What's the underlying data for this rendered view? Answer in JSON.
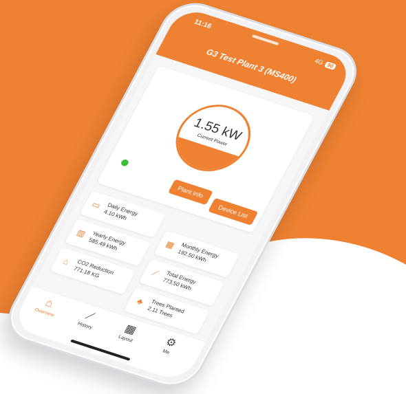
{
  "colors": {
    "accent": "#ef8232",
    "status_online": "#3bbf3b"
  },
  "status_bar": {
    "time": "11:16",
    "network": "4G",
    "battery": "90"
  },
  "header": {
    "title": "G3 Test Plant 3 (MS400)"
  },
  "power": {
    "value": "1.55 kW",
    "label": "Current Power",
    "fill_fraction": 0.35
  },
  "actions": {
    "plant_info": "Plant Info",
    "device_list": "Device List"
  },
  "stats": [
    {
      "name": "Daily Energy",
      "value": "4.10 kWh",
      "icon": "battery-icon"
    },
    {
      "name": "Yearly Energy",
      "value": "585.49 kWh",
      "icon": "bar-chart-icon"
    },
    {
      "name": "Monthly Energy",
      "value": "192.50 kWh",
      "icon": "calendar-icon"
    },
    {
      "name": "CO2 Reduction",
      "value": "771.18 KG",
      "icon": "house-leaf-icon"
    },
    {
      "name": "Total Energy",
      "value": "773.50 kWh",
      "icon": "line-chart-icon"
    },
    {
      "name": "Trees Planted",
      "value": "2.11 Trees",
      "icon": "tree-icon"
    }
  ],
  "tabs": [
    {
      "label": "Overview",
      "icon": "home-icon",
      "active": true
    },
    {
      "label": "History",
      "icon": "line-chart-icon"
    },
    {
      "label": "Layout",
      "icon": "grid-icon"
    },
    {
      "label": "Me",
      "icon": "gear-icon"
    }
  ]
}
